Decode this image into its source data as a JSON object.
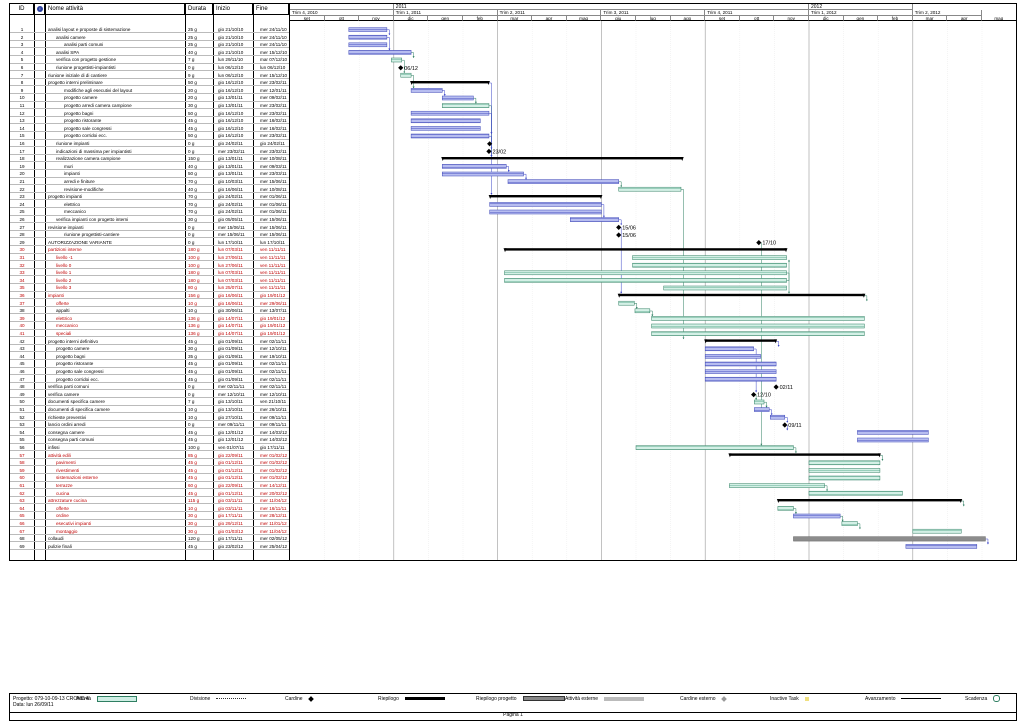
{
  "columns": {
    "id": "ID",
    "indicators": "i",
    "name": "Nome attività",
    "duration": "Durata",
    "start": "Inizio",
    "end": "Fine"
  },
  "timescale": {
    "years": [
      {
        "label": "",
        "start": 0,
        "end": 3
      },
      {
        "label": "2011",
        "start": 3,
        "end": 15
      },
      {
        "label": "2012",
        "start": 15,
        "end": 18
      }
    ],
    "quarters": [
      {
        "label": "Trim 4, 2010",
        "start": 0,
        "end": 3
      },
      {
        "label": "Trim 1, 2011",
        "start": 3,
        "end": 6
      },
      {
        "label": "Trim 2, 2011",
        "start": 6,
        "end": 9
      },
      {
        "label": "Trim 3, 2011",
        "start": 9,
        "end": 12
      },
      {
        "label": "Trim 4, 2011",
        "start": 12,
        "end": 15
      },
      {
        "label": "Trim 1, 2012",
        "start": 15,
        "end": 18
      },
      {
        "label": "Trim 2, 2012",
        "start": 18,
        "end": 20
      }
    ],
    "months": [
      "set",
      "ott",
      "nov",
      "dic",
      "gen",
      "feb",
      "mar",
      "apr",
      "mag",
      "giu",
      "lug",
      "ago",
      "set",
      "ott",
      "nov",
      "dic",
      "gen",
      "feb",
      "mar",
      "apr",
      "mag"
    ]
  },
  "tasks": [
    {
      "id": "1",
      "name": "analisi layout e proposte di sistemazione",
      "dur": "25 g",
      "start": "gio 21/10/10",
      "end": "mer 24/11/10",
      "i": 0,
      "s": 1.7,
      "e": 2.8,
      "k": "t"
    },
    {
      "id": "2",
      "name": "analisi camere",
      "dur": "25 g",
      "start": "gio 21/10/10",
      "end": "mer 24/11/10",
      "i": 1,
      "s": 1.7,
      "e": 2.8,
      "k": "t",
      "icon": 1
    },
    {
      "id": "3",
      "name": "analisi parti comuni",
      "dur": "25 g",
      "start": "gio 21/10/10",
      "end": "mer 24/11/10",
      "i": 2,
      "s": 1.7,
      "e": 2.8,
      "k": "t"
    },
    {
      "id": "4",
      "name": "analisi SPA",
      "dur": "40 g",
      "start": "gio 21/10/10",
      "end": "mer 15/12/10",
      "i": 1,
      "s": 1.7,
      "e": 3.5,
      "k": "t",
      "icon": 1
    },
    {
      "id": "5",
      "name": "verifica con progetto gestione",
      "dur": "7 g",
      "start": "lun 29/11/10",
      "end": "mar 07/12/10",
      "i": 1,
      "s": 2.93,
      "e": 3.23,
      "k": "d",
      "icon": 1
    },
    {
      "id": "6",
      "name": "riunione progettisti-impiantisti",
      "dur": "0 g",
      "start": "lun 06/12/10",
      "end": "lun 06/12/10",
      "i": 1,
      "s": 3.2,
      "k": "m",
      "ml": "06/12",
      "icon": 1
    },
    {
      "id": "7",
      "name": "riunione iniziale di di cantiere",
      "dur": "9 g",
      "start": "lun 06/12/10",
      "end": "mer 15/12/10",
      "i": 0,
      "s": 3.2,
      "e": 3.5,
      "k": "d"
    },
    {
      "id": "8",
      "name": "progetto interni preliminare",
      "dur": "50 g",
      "start": "gio 16/12/10",
      "end": "mer 23/02/11",
      "i": 0,
      "s": 3.5,
      "e": 5.75,
      "k": "s",
      "icon": 2
    },
    {
      "id": "9",
      "name": "modifiche agli esecutivi del layout",
      "dur": "20 g",
      "start": "gio 16/12/10",
      "end": "mer 12/01/11",
      "i": 2,
      "s": 3.5,
      "e": 4.4,
      "k": "t"
    },
    {
      "id": "10",
      "name": "progetto camere",
      "dur": "20 g",
      "start": "gio 13/01/11",
      "end": "mer 09/02/11",
      "i": 2,
      "s": 4.4,
      "e": 5.3,
      "k": "t"
    },
    {
      "id": "11",
      "name": "progetto arredi camera campione",
      "dur": "30 g",
      "start": "gio 13/01/11",
      "end": "mer 23/02/11",
      "i": 2,
      "s": 4.4,
      "e": 5.75,
      "k": "d"
    },
    {
      "id": "12",
      "name": "progetto bagni",
      "dur": "50 g",
      "start": "gio 16/12/10",
      "end": "mer 23/02/11",
      "i": 2,
      "s": 3.5,
      "e": 5.75,
      "k": "t"
    },
    {
      "id": "13",
      "name": "progetto ristorante",
      "dur": "45 g",
      "start": "gio 16/12/10",
      "end": "mer 16/02/11",
      "i": 2,
      "s": 3.5,
      "e": 5.5,
      "k": "t"
    },
    {
      "id": "14",
      "name": "progetto sale congressi",
      "dur": "45 g",
      "start": "gio 16/12/10",
      "end": "mer 16/02/11",
      "i": 2,
      "s": 3.5,
      "e": 5.5,
      "k": "t"
    },
    {
      "id": "15",
      "name": "progetto corridoi ecc.",
      "dur": "50 g",
      "start": "gio 16/12/10",
      "end": "mer 23/02/11",
      "i": 2,
      "s": 3.5,
      "e": 5.75,
      "k": "t"
    },
    {
      "id": "16",
      "name": "riunione impianti",
      "dur": "0 g",
      "start": "gio 24/02/11",
      "end": "gio 24/02/11",
      "i": 1,
      "s": 5.77,
      "k": "m",
      "ml": ""
    },
    {
      "id": "17",
      "name": "indicazioni di massima per impiantisti",
      "dur": "0 g",
      "start": "mer 23/02/11",
      "end": "mer 23/02/11",
      "i": 1,
      "s": 5.75,
      "k": "m",
      "ml": "23/02"
    },
    {
      "id": "18",
      "name": "realizzazione camera campione",
      "dur": "150 g",
      "start": "gio 13/01/11",
      "end": "mer 10/08/11",
      "i": 1,
      "s": 4.4,
      "e": 11.35,
      "k": "s"
    },
    {
      "id": "19",
      "name": "muri",
      "dur": "40 g",
      "start": "gio 13/01/11",
      "end": "mer 09/03/11",
      "i": 2,
      "s": 4.4,
      "e": 6.25,
      "k": "t",
      "icon": 1
    },
    {
      "id": "20",
      "name": "impianti",
      "dur": "50 g",
      "start": "gio 13/01/11",
      "end": "mer 23/03/11",
      "i": 2,
      "s": 4.4,
      "e": 6.75,
      "k": "t"
    },
    {
      "id": "21",
      "name": "arredi e finiture",
      "dur": "70 g",
      "start": "gio 10/03/11",
      "end": "mer 15/06/11",
      "i": 2,
      "s": 6.3,
      "e": 9.5,
      "k": "t"
    },
    {
      "id": "22",
      "name": "revisione-modifiche",
      "dur": "40 g",
      "start": "gio 16/06/11",
      "end": "mer 10/08/11",
      "i": 2,
      "s": 9.5,
      "e": 11.3,
      "k": "d"
    },
    {
      "id": "23",
      "name": "progetto impianti",
      "dur": "70 g",
      "start": "gio 24/02/11",
      "end": "mer 01/06/11",
      "i": 0,
      "s": 5.77,
      "e": 9.0,
      "k": "s",
      "icon": 3
    },
    {
      "id": "24",
      "name": "elettrico",
      "dur": "70 g",
      "start": "gio 24/02/11",
      "end": "mer 01/06/11",
      "i": 2,
      "s": 5.77,
      "e": 9.0,
      "k": "t"
    },
    {
      "id": "25",
      "name": "meccanico",
      "dur": "70 g",
      "start": "gio 24/02/11",
      "end": "mer 01/06/11",
      "i": 2,
      "s": 5.77,
      "e": 9.0,
      "k": "t"
    },
    {
      "id": "26",
      "name": "verifica impianti con progetto interni",
      "dur": "30 g",
      "start": "gio 05/05/11",
      "end": "mer 15/06/11",
      "i": 1,
      "s": 8.1,
      "e": 9.5,
      "k": "t"
    },
    {
      "id": "27",
      "name": "revisione impianti",
      "dur": "0 g",
      "start": "mer 15/06/11",
      "end": "mer 15/06/11",
      "i": 0,
      "s": 9.5,
      "k": "m",
      "ml": "15/06"
    },
    {
      "id": "28",
      "name": "riunione progettisti-cantiere",
      "dur": "0 g",
      "start": "mer 15/06/11",
      "end": "mer 15/06/11",
      "i": 2,
      "s": 9.5,
      "k": "m",
      "ml": "15/06"
    },
    {
      "id": "29",
      "name": "AUTORIZZAZIONE VARIANTE",
      "dur": "0 g",
      "start": "lun 17/10/11",
      "end": "lun 17/10/11",
      "i": 0,
      "s": 13.55,
      "k": "m",
      "ml": "17/10",
      "icon": 1
    },
    {
      "id": "30",
      "name": "partizioni interne",
      "dur": "180 g",
      "start": "lun 07/03/11",
      "end": "ven 11/11/11",
      "i": 0,
      "s": 6.2,
      "e": 14.35,
      "k": "s",
      "red": 1
    },
    {
      "id": "31",
      "name": "livello -1",
      "dur": "100 g",
      "start": "lun 27/06/11",
      "end": "ven 11/11/11",
      "i": 1,
      "s": 9.9,
      "e": 14.35,
      "k": "d",
      "red": 1
    },
    {
      "id": "32",
      "name": "livello 0",
      "dur": "100 g",
      "start": "lun 27/06/11",
      "end": "ven 11/11/11",
      "i": 1,
      "s": 9.9,
      "e": 14.35,
      "k": "d",
      "red": 1
    },
    {
      "id": "33",
      "name": "livello 1",
      "dur": "180 g",
      "start": "lun 07/03/11",
      "end": "ven 11/11/11",
      "i": 1,
      "s": 6.2,
      "e": 14.35,
      "k": "d",
      "red": 1
    },
    {
      "id": "34",
      "name": "livello 2",
      "dur": "180 g",
      "start": "lun 07/03/11",
      "end": "ven 11/11/11",
      "i": 1,
      "s": 6.2,
      "e": 14.35,
      "k": "d",
      "red": 1
    },
    {
      "id": "35",
      "name": "livello 3",
      "dur": "80 g",
      "start": "lun 25/07/11",
      "end": "ven 11/11/11",
      "i": 1,
      "s": 10.8,
      "e": 14.35,
      "k": "d",
      "red": 1,
      "icon": 1
    },
    {
      "id": "36",
      "name": "impianti",
      "dur": "156 g",
      "start": "gio 16/06/11",
      "end": "gio 19/01/12",
      "i": 0,
      "s": 9.5,
      "e": 16.6,
      "k": "s",
      "red": 1
    },
    {
      "id": "37",
      "name": "offerte",
      "dur": "10 g",
      "start": "gio 16/06/11",
      "end": "mer 29/06/11",
      "i": 1,
      "s": 9.5,
      "e": 9.95,
      "k": "d",
      "red": 1
    },
    {
      "id": "38",
      "name": "appalti",
      "dur": "10 g",
      "start": "gio 30/06/11",
      "end": "mer 13/07/11",
      "i": 1,
      "s": 9.97,
      "e": 10.4,
      "k": "d"
    },
    {
      "id": "39",
      "name": "elettrico",
      "dur": "136 g",
      "start": "gio 14/07/11",
      "end": "gio 19/01/12",
      "i": 1,
      "s": 10.45,
      "e": 16.6,
      "k": "d",
      "red": 1
    },
    {
      "id": "40",
      "name": "meccanico",
      "dur": "136 g",
      "start": "gio 14/07/11",
      "end": "gio 19/01/12",
      "i": 1,
      "s": 10.45,
      "e": 16.6,
      "k": "d",
      "red": 1
    },
    {
      "id": "41",
      "name": "speciali",
      "dur": "136 g",
      "start": "gio 14/07/11",
      "end": "gio 19/01/12",
      "i": 1,
      "s": 10.45,
      "e": 16.6,
      "k": "d",
      "red": 1
    },
    {
      "id": "42",
      "name": "progetto interni definitivo",
      "dur": "45 g",
      "start": "gio 01/09/11",
      "end": "mer 02/11/11",
      "i": 0,
      "s": 12.0,
      "e": 14.05,
      "k": "s",
      "icon": 3
    },
    {
      "id": "43",
      "name": "progetto camere",
      "dur": "30 g",
      "start": "gio 01/09/11",
      "end": "mer 12/10/11",
      "i": 1,
      "s": 12.0,
      "e": 13.4,
      "k": "t",
      "icon": 1
    },
    {
      "id": "44",
      "name": "progetto bagni",
      "dur": "35 g",
      "start": "gio 01/09/11",
      "end": "mer 19/10/11",
      "i": 1,
      "s": 12.0,
      "e": 13.6,
      "k": "t"
    },
    {
      "id": "45",
      "name": "progetto ristorante",
      "dur": "45 g",
      "start": "gio 01/09/11",
      "end": "mer 02/11/11",
      "i": 1,
      "s": 12.0,
      "e": 14.05,
      "k": "t",
      "icon": 1
    },
    {
      "id": "46",
      "name": "progetto sale congressi",
      "dur": "45 g",
      "start": "gio 01/09/11",
      "end": "mer 02/11/11",
      "i": 1,
      "s": 12.0,
      "e": 14.05,
      "k": "t"
    },
    {
      "id": "47",
      "name": "progetto corridoi ecc.",
      "dur": "45 g",
      "start": "gio 01/09/11",
      "end": "mer 02/11/11",
      "i": 1,
      "s": 12.0,
      "e": 14.05,
      "k": "t"
    },
    {
      "id": "48",
      "name": "verifica parti comuni",
      "dur": "0 g",
      "start": "mer 02/11/11",
      "end": "mer 02/11/11",
      "i": 0,
      "s": 14.05,
      "k": "m",
      "ml": "02/11",
      "icon": 4
    },
    {
      "id": "49",
      "name": "verifica camere",
      "dur": "0 g",
      "start": "mer 12/10/11",
      "end": "mer 12/10/11",
      "i": 0,
      "s": 13.4,
      "k": "m",
      "ml": "12/10"
    },
    {
      "id": "50",
      "name": "documenti specifica camere",
      "dur": "7 g",
      "start": "gio 13/10/11",
      "end": "ven 21/10/11",
      "i": 0,
      "s": 13.42,
      "e": 13.7,
      "k": "d"
    },
    {
      "id": "51",
      "name": "documenti di specifica camere",
      "dur": "10 g",
      "start": "gio 13/10/11",
      "end": "mer 26/10/11",
      "i": 0,
      "s": 13.42,
      "e": 13.85,
      "k": "t"
    },
    {
      "id": "52",
      "name": "richieste preventivi",
      "dur": "10 g",
      "start": "gio 27/10/11",
      "end": "mer 09/11/11",
      "i": 0,
      "s": 13.88,
      "e": 14.3,
      "k": "t"
    },
    {
      "id": "53",
      "name": "lancio ordini arredi",
      "dur": "0 g",
      "start": "mer 09/11/11",
      "end": "mer 09/11/11",
      "i": 0,
      "s": 14.3,
      "k": "m",
      "ml": "09/11",
      "icon": 1
    },
    {
      "id": "54",
      "name": "consegna camere",
      "dur": "45 g",
      "start": "gio 12/01/12",
      "end": "mer 14/03/12",
      "i": 0,
      "s": 16.4,
      "e": 18.45,
      "k": "t"
    },
    {
      "id": "55",
      "name": "consegna parti comuni",
      "dur": "45 g",
      "start": "gio 12/01/12",
      "end": "mer 14/03/12",
      "i": 0,
      "s": 16.4,
      "e": 18.45,
      "k": "t"
    },
    {
      "id": "56",
      "name": "infissi",
      "dur": "100 g",
      "start": "ven 01/07/11",
      "end": "gio 17/11/11",
      "i": 0,
      "s": 10.0,
      "e": 14.55,
      "k": "d",
      "icon": 1
    },
    {
      "id": "57",
      "name": "attività edili",
      "dur": "85 g",
      "start": "gio 22/09/11",
      "end": "mer 01/02/12",
      "i": 0,
      "s": 12.7,
      "e": 17.05,
      "k": "s",
      "red": 1
    },
    {
      "id": "58",
      "name": "pavimenti",
      "dur": "45 g",
      "start": "gio 01/12/11",
      "end": "mer 01/02/12",
      "i": 1,
      "s": 15.0,
      "e": 17.05,
      "k": "d",
      "red": 1,
      "icon": 1
    },
    {
      "id": "59",
      "name": "rivestimenti",
      "dur": "45 g",
      "start": "gio 01/12/11",
      "end": "mer 01/02/12",
      "i": 1,
      "s": 15.0,
      "e": 17.05,
      "k": "d",
      "red": 1,
      "icon": 1
    },
    {
      "id": "60",
      "name": "sistemazioni esterne",
      "dur": "45 g",
      "start": "gio 01/12/11",
      "end": "mer 01/02/12",
      "i": 1,
      "s": 15.0,
      "e": 17.05,
      "k": "d",
      "red": 1,
      "icon": 1
    },
    {
      "id": "61",
      "name": "terrazze",
      "dur": "60 g",
      "start": "gio 22/09/11",
      "end": "mer 14/12/11",
      "i": 1,
      "s": 12.7,
      "e": 15.45,
      "k": "d",
      "red": 1
    },
    {
      "id": "62",
      "name": "cucina",
      "dur": "45 g",
      "start": "gio 01/12/11",
      "end": "mer 20/02/12",
      "i": 1,
      "s": 15.0,
      "e": 17.7,
      "k": "d",
      "red": 1
    },
    {
      "id": "63",
      "name": "attrezzature cucina",
      "dur": "115 g",
      "start": "gio 03/11/11",
      "end": "mer 11/04/12",
      "i": 0,
      "s": 14.1,
      "e": 19.4,
      "k": "s",
      "red": 1
    },
    {
      "id": "64",
      "name": "offerte",
      "dur": "10 g",
      "start": "gio 03/11/11",
      "end": "mer 16/11/11",
      "i": 1,
      "s": 14.1,
      "e": 14.55,
      "k": "d",
      "red": 1
    },
    {
      "id": "65",
      "name": "ordine",
      "dur": "30 g",
      "start": "gio 17/11/11",
      "end": "mer 28/12/11",
      "i": 1,
      "s": 14.55,
      "e": 15.9,
      "k": "t",
      "red": 1
    },
    {
      "id": "66",
      "name": "esecutivi impianti",
      "dur": "30 g",
      "start": "gio 29/12/11",
      "end": "mer 11/01/12",
      "i": 1,
      "s": 15.95,
      "e": 16.4,
      "k": "d",
      "red": 1
    },
    {
      "id": "67",
      "name": "montaggio",
      "dur": "30 g",
      "start": "gio 01/03/12",
      "end": "mer 11/04/12",
      "i": 1,
      "s": 18.0,
      "e": 19.4,
      "k": "d",
      "red": 1
    },
    {
      "id": "68",
      "name": "collaudi",
      "dur": "120 g",
      "start": "gio 17/11/11",
      "end": "mer 02/05/12",
      "i": 0,
      "s": 14.55,
      "e": 20.1,
      "k": "x"
    },
    {
      "id": "69",
      "name": "pulizie finali",
      "dur": "45 g",
      "start": "gio 23/02/12",
      "end": "mer 25/04/12",
      "i": 0,
      "s": 17.8,
      "e": 19.85,
      "k": "t"
    }
  ],
  "legend": {
    "project": "Progetto: 079-10-09-13 CRONO 4",
    "date": "Data: lun 26/09/11",
    "items": [
      {
        "label": "Attività",
        "sym": "task"
      },
      {
        "label": "Divisione",
        "sym": "split"
      },
      {
        "label": "Cardine",
        "sym": "milestone"
      },
      {
        "label": "Riepilogo",
        "sym": "summary"
      },
      {
        "label": "Riepilogo progetto",
        "sym": "projsummary"
      },
      {
        "label": "Attività esterne",
        "sym": "external"
      },
      {
        "label": "Cardine esterno",
        "sym": "extmilestone"
      },
      {
        "label": "Inactive Task",
        "sym": "inactive"
      },
      {
        "label": "Avanzamento",
        "sym": "progress"
      },
      {
        "label": "Scadenza",
        "sym": "deadline"
      }
    ]
  },
  "footer": {
    "page": "Pagina 1"
  },
  "colors": {
    "task": "#9fa8e6",
    "taskBorder": "#3f49b8",
    "critical": "#b7e6d6",
    "criticalBorder": "#2f7f62",
    "summary": "#000000",
    "link": "#3b45c8",
    "linkGreen": "#2f7f62",
    "red": "#c00000"
  }
}
